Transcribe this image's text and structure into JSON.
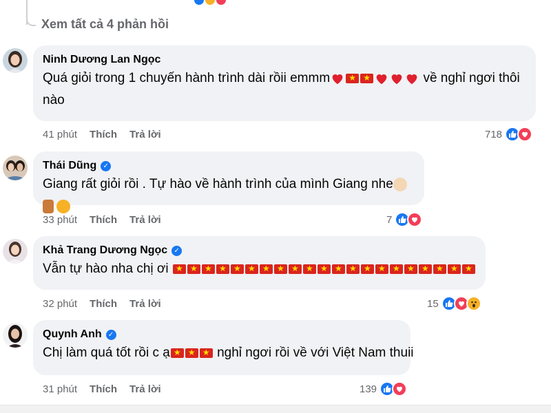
{
  "thread": {
    "see_all_label": "Xem tất cả 4 phản hồi"
  },
  "comments": [
    {
      "name": "Ninh Dương Lan Ngọc",
      "verified": false,
      "text_before": "Quá giỏi trong 1 chuyến hành trình dài rồii emmm",
      "text_after": " về nghỉ ngơi thôi",
      "text_line2": "nào",
      "time": "41 phút",
      "like_label": "Thích",
      "reply_label": "Trả lời",
      "reaction_count": "718",
      "reactions": [
        "like-icon",
        "love-icon"
      ]
    },
    {
      "name": "Thái Dũng",
      "verified": true,
      "text": "Giang rất giỏi rồi . Tự hào về hành trình của mình Giang nhe",
      "time": "33 phút",
      "like_label": "Thích",
      "reply_label": "Trả lời",
      "reaction_count": "7",
      "reactions": [
        "like-icon",
        "love-icon"
      ]
    },
    {
      "name": "Khả Trang Dương Ngọc",
      "verified": true,
      "text": "Vẫn tự hào nha chị ơi",
      "time": "32 phút",
      "like_label": "Thích",
      "reply_label": "Trả lời",
      "reaction_count": "15",
      "reactions": [
        "like-icon",
        "love-icon",
        "wow-icon"
      ]
    },
    {
      "name": "Quynh Anh",
      "verified": true,
      "text_before": "Chị làm quá tốt rồi c ạ",
      "text_after": " nghỉ ngơi rồi về với Việt Nam thuii",
      "time": "31 phút",
      "like_label": "Thích",
      "reply_label": "Trả lời",
      "reaction_count": "139",
      "reactions": [
        "like-icon",
        "love-icon"
      ]
    }
  ],
  "colors": {
    "bubble": "#f0f2f5",
    "meta_text": "#65676b",
    "like": "#1877f2",
    "love": "#f33e58",
    "wow": "#f7b125",
    "flag_red": "#da251d",
    "flag_star": "#ffde00"
  }
}
